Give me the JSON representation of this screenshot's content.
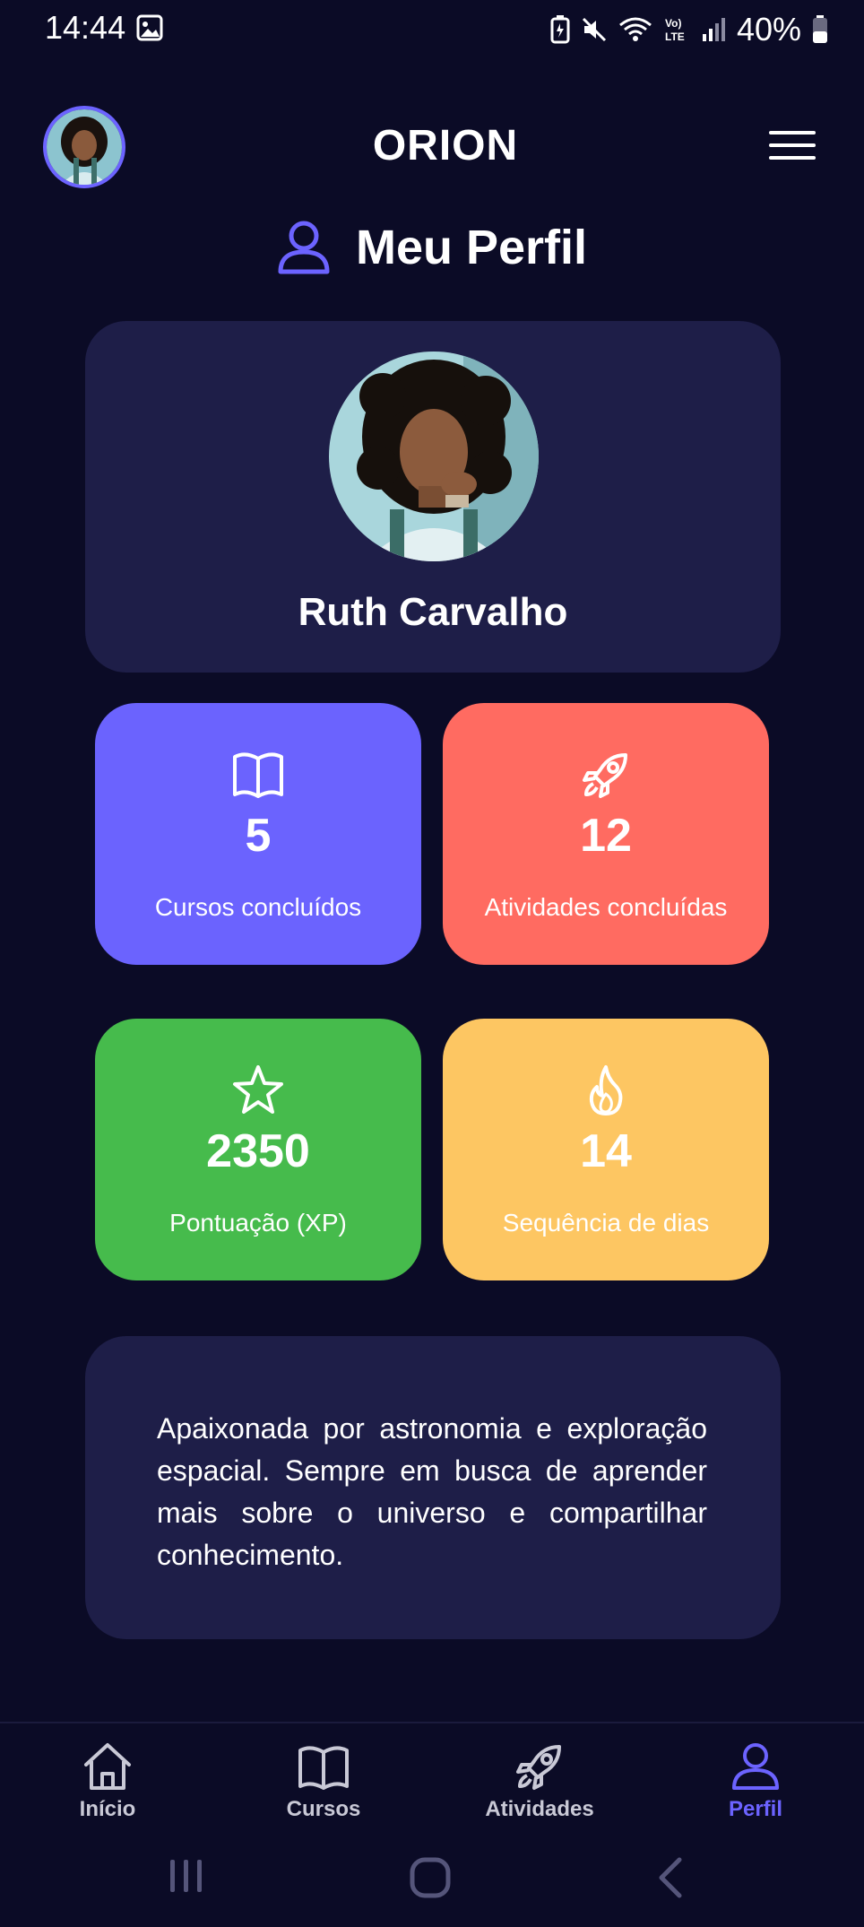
{
  "status_bar": {
    "time": "14:44",
    "battery": "40%"
  },
  "header": {
    "logo_text": "ORION"
  },
  "title": "Meu Perfil",
  "profile": {
    "name": "Ruth Carvalho"
  },
  "stats": [
    {
      "value": "5",
      "label": "Cursos concluídos",
      "icon": "book-icon",
      "color": "#6b63fe"
    },
    {
      "value": "12",
      "label": "Atividades concluídas",
      "icon": "rocket-icon",
      "color": "#ff6b61"
    },
    {
      "value": "2350",
      "label": "Pontuação (XP)",
      "icon": "star-icon",
      "color": "#46bb4c"
    },
    {
      "value": "14",
      "label": "Sequência de dias",
      "icon": "flame-icon",
      "color": "#fdc662"
    }
  ],
  "bio": "Apaixonada por astronomia e exploração espacial. Sempre em busca de aprender mais sobre o universo e compartilhar conhecimento.",
  "nav": {
    "items": [
      {
        "label": "Início",
        "icon": "home-icon"
      },
      {
        "label": "Cursos",
        "icon": "book-icon"
      },
      {
        "label": "Atividades",
        "icon": "rocket-icon"
      },
      {
        "label": "Perfil",
        "icon": "user-icon"
      }
    ],
    "active": "Perfil",
    "accent": "#6c63ff"
  }
}
